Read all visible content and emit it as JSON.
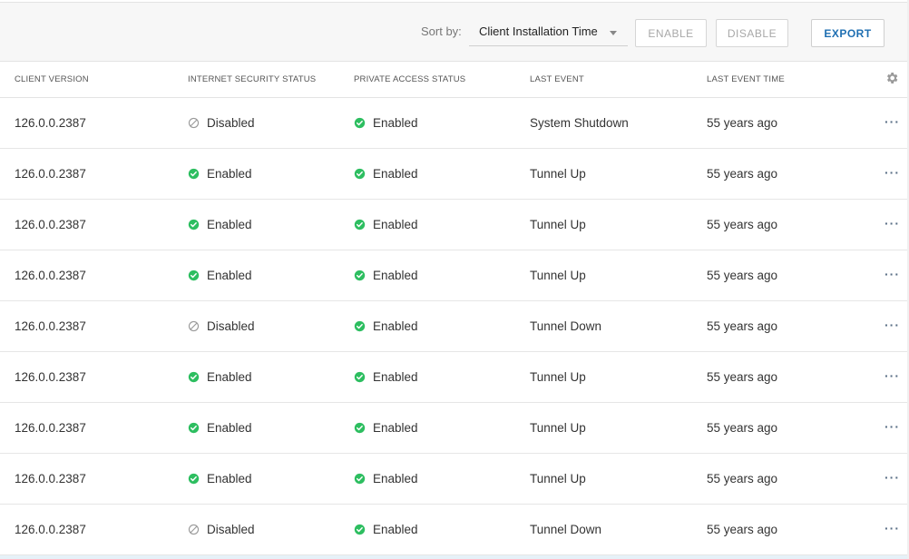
{
  "toolbar": {
    "sort_label": "Sort by:",
    "sort_value": "Client Installation Time",
    "enable_label": "ENABLE",
    "disable_label": "DISABLE",
    "export_label": "EXPORT"
  },
  "table": {
    "headers": {
      "client_version": "CLIENT VERSION",
      "internet_security_status": "INTERNET SECURITY STATUS",
      "private_access_status": "PRIVATE ACCESS STATUS",
      "last_event": "LAST EVENT",
      "last_event_time": "LAST EVENT TIME"
    },
    "rows": [
      {
        "version": "126.0.0.2387",
        "isec": "Disabled",
        "priv": "Enabled",
        "event": "System Shutdown",
        "time": "55 years ago"
      },
      {
        "version": "126.0.0.2387",
        "isec": "Enabled",
        "priv": "Enabled",
        "event": "Tunnel Up",
        "time": "55 years ago"
      },
      {
        "version": "126.0.0.2387",
        "isec": "Enabled",
        "priv": "Enabled",
        "event": "Tunnel Up",
        "time": "55 years ago"
      },
      {
        "version": "126.0.0.2387",
        "isec": "Enabled",
        "priv": "Enabled",
        "event": "Tunnel Up",
        "time": "55 years ago"
      },
      {
        "version": "126.0.0.2387",
        "isec": "Disabled",
        "priv": "Enabled",
        "event": "Tunnel Down",
        "time": "55 years ago"
      },
      {
        "version": "126.0.0.2387",
        "isec": "Enabled",
        "priv": "Enabled",
        "event": "Tunnel Up",
        "time": "55 years ago"
      },
      {
        "version": "126.0.0.2387",
        "isec": "Enabled",
        "priv": "Enabled",
        "event": "Tunnel Up",
        "time": "55 years ago"
      },
      {
        "version": "126.0.0.2387",
        "isec": "Enabled",
        "priv": "Enabled",
        "event": "Tunnel Up",
        "time": "55 years ago"
      },
      {
        "version": "126.0.0.2387",
        "isec": "Disabled",
        "priv": "Enabled",
        "event": "Tunnel Down",
        "time": "55 years ago"
      }
    ]
  },
  "icons": {
    "enabled": "check-circle-icon",
    "disabled": "disabled-circle-icon",
    "settings": "gear-icon",
    "row_menu": "more-horizontal-icon"
  },
  "colors": {
    "enabled": "#2dbe60",
    "disabled": "#9a9a9a",
    "accent": "#1f6fb2"
  },
  "more_glyph": "···"
}
